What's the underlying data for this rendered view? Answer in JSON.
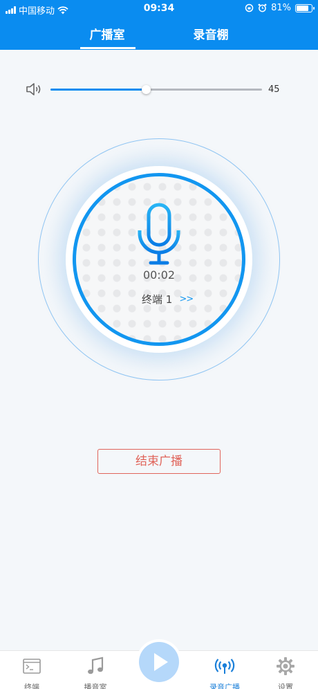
{
  "status_bar": {
    "carrier": "中国移动",
    "time": "09:34",
    "battery_percent": "81%",
    "battery_level": 0.81
  },
  "tabs": [
    {
      "label": "广播室",
      "active": true
    },
    {
      "label": "录音棚",
      "active": false
    }
  ],
  "volume": {
    "value": "45",
    "level": 0.45,
    "icon": "speaker-icon"
  },
  "broadcast": {
    "timer": "00:02",
    "terminal_label": "终端 1",
    "more_arrows": ">>"
  },
  "end_button_label": "结束广播",
  "bottom_nav": [
    {
      "label": "终端",
      "icon": "terminal-icon",
      "active": false
    },
    {
      "label": "播音室",
      "icon": "music-note-icon",
      "active": false
    },
    {
      "label": "",
      "icon": "play-icon",
      "active": false
    },
    {
      "label": "录音广播",
      "icon": "broadcast-icon",
      "active": true
    },
    {
      "label": "设置",
      "icon": "gear-icon",
      "active": false
    }
  ],
  "colors": {
    "primary": "#0a8cf0",
    "ring": "#1296f0",
    "danger": "#e0645a",
    "nav_active": "#1a7fd9"
  }
}
